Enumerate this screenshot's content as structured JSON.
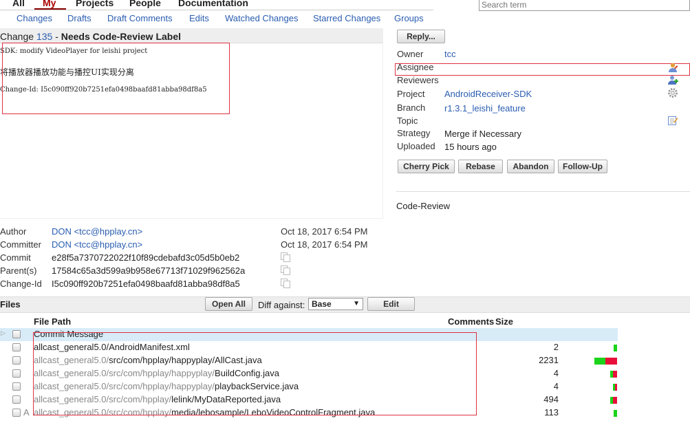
{
  "topnav": {
    "all": "All",
    "my": "My",
    "projects": "Projects",
    "people": "People",
    "documentation": "Documentation"
  },
  "search": {
    "placeholder": "Search term"
  },
  "submenu": [
    "Changes",
    "Drafts",
    "Draft Comments",
    "Edits",
    "Watched Changes",
    "Starred Changes",
    "Groups"
  ],
  "change": {
    "prefix": "Change",
    "number": "135",
    "separator": "-",
    "status": "Needs Code-Review Label",
    "message_line1": "SDK: modify VideoPlayer for leishi project",
    "message_line2": "将播放器播放功能与播控UI实现分离",
    "message_line3": "Change-Id: I5c090ff920b7251efa0498baafd81abba98df8a5"
  },
  "actions": {
    "reply": "Reply...",
    "cherry_pick": "Cherry Pick",
    "rebase": "Rebase",
    "abandon": "Abandon",
    "follow_up": "Follow-Up"
  },
  "info": {
    "owner_label": "Owner",
    "owner": "tcc",
    "assignee_label": "Assignee",
    "reviewers_label": "Reviewers",
    "project_label": "Project",
    "project": "AndroidReceiver-SDK",
    "branch_label": "Branch",
    "branch": "r1.3.1_leishi_feature",
    "topic_label": "Topic",
    "strategy_label": "Strategy",
    "strategy": "Merge if Necessary",
    "uploaded_label": "Uploaded",
    "uploaded": "15 hours ago",
    "code_review_label": "Code-Review"
  },
  "meta": {
    "author_label": "Author",
    "author": "DON <tcc@hpplay.cn>",
    "author_date": "Oct 18, 2017 6:54 PM",
    "committer_label": "Committer",
    "committer": "DON <tcc@hpplay.cn>",
    "committer_date": "Oct 18, 2017 6:54 PM",
    "commit_label": "Commit",
    "commit": "e28f5a7370722022f10f89cdebafd3c05d5b0eb2",
    "parents_label": "Parent(s)",
    "parents": "17584c65a3d599a9b958e67713f71029f962562a",
    "changeid_label": "Change-Id",
    "changeid": "I5c090ff920b7251efa0498baafd81abba98df8a5"
  },
  "files": {
    "label": "Files",
    "open_all": "Open All",
    "diff_against_label": "Diff against:",
    "diff_base": "Base",
    "edit": "Edit",
    "col_path": "File Path",
    "col_comments": "Comments",
    "col_size": "Size",
    "rows": [
      {
        "dir": "",
        "name": "Commit Message",
        "size": ""
      },
      {
        "dir": "",
        "name": "allcast_general5.0/AndroidManifest.xml",
        "size": "2"
      },
      {
        "dir": "allcast_general5.0/",
        "name": "src/com/hpplay/happyplay/AllCast.java",
        "size": "2231"
      },
      {
        "dir": "allcast_general5.0/src/com/hpplay/happyplay/",
        "name": "BuildConfig.java",
        "size": "4"
      },
      {
        "dir": "allcast_general5.0/src/com/hpplay/happyplay/",
        "name": "playbackService.java",
        "size": "4"
      },
      {
        "dir": "allcast_general5.0/src/com/hpplay/",
        "name": "lelink/MyDataReported.java",
        "size": "494"
      },
      {
        "dir": "allcast_general5.0/src/com/hpplay/",
        "name": "media/lebosample/LeboVideoControlFragment.java",
        "size": "113",
        "marker": "A"
      }
    ]
  },
  "colors": {
    "accent": "#2a5db0",
    "annotation": "#e03040",
    "added": "#1ad31a",
    "removed": "#e8103a"
  }
}
